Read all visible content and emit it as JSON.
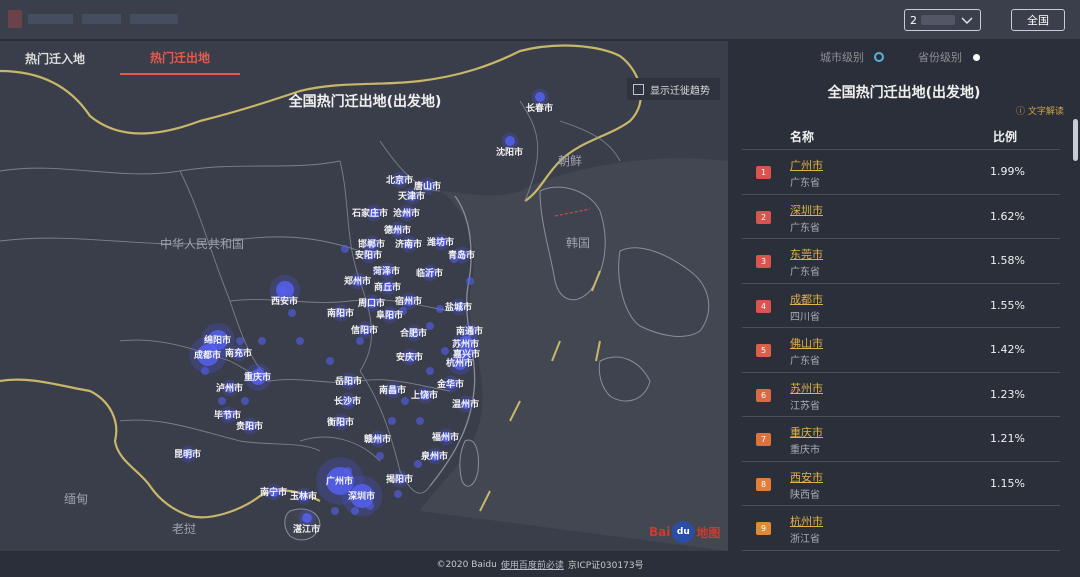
{
  "header": {
    "year_select_value": "2",
    "all_button": "全国"
  },
  "map": {
    "tabs": [
      "热门迁入地",
      "热门迁出地"
    ],
    "title": "全国热门迁出地(出发地)",
    "trend_toggle_label": "显示迁徙趋势",
    "country_labels": [
      "中华人民共和国",
      "朝鲜",
      "韩国",
      "缅甸",
      "老挝"
    ],
    "cities": [
      "长春市",
      "沈阳市",
      "北京市",
      "唐山市",
      "天津市",
      "石家庄市",
      "沧州市",
      "德州市",
      "邯郸市",
      "济南市",
      "潍坊市",
      "安阳市",
      "青岛市",
      "菏泽市",
      "临沂市",
      "郑州市",
      "西安市",
      "商丘市",
      "周口市",
      "宿州市",
      "阜阳市",
      "盐城市",
      "南阳市",
      "信阳市",
      "合肥市",
      "南通市",
      "苏州市",
      "嘉兴市",
      "杭州市",
      "绵阳市",
      "南充市",
      "安庆市",
      "成都市",
      "重庆市",
      "泸州市",
      "岳阳市",
      "南昌市",
      "金华市",
      "毕节市",
      "长沙市",
      "上饶市",
      "温州市",
      "贵阳市",
      "衡阳市",
      "赣州市",
      "福州市",
      "昆明市",
      "泉州市",
      "南宁市",
      "玉林市",
      "揭阳市",
      "湛江市",
      "广州市",
      "深圳市"
    ],
    "baidu_logo": [
      "Bai",
      "du",
      "地图"
    ]
  },
  "footer": {
    "copyright": "©2020 Baidu",
    "link": "使用百度前必读",
    "icp": "京ICP证030173号"
  },
  "panel": {
    "tabs": [
      "城市级别",
      "省份级别"
    ],
    "title": "全国热门迁出地(出发地)",
    "help_text": "文字解读",
    "columns": [
      "名称",
      "比例"
    ],
    "rows": [
      {
        "rank": "1",
        "city": "广州市",
        "province": "广东省",
        "pct": "1.99%"
      },
      {
        "rank": "2",
        "city": "深圳市",
        "province": "广东省",
        "pct": "1.62%"
      },
      {
        "rank": "3",
        "city": "东莞市",
        "province": "广东省",
        "pct": "1.58%"
      },
      {
        "rank": "4",
        "city": "成都市",
        "province": "四川省",
        "pct": "1.55%"
      },
      {
        "rank": "5",
        "city": "佛山市",
        "province": "广东省",
        "pct": "1.42%"
      },
      {
        "rank": "6",
        "city": "苏州市",
        "province": "江苏省",
        "pct": "1.23%"
      },
      {
        "rank": "7",
        "city": "重庆市",
        "province": "重庆市",
        "pct": "1.21%"
      },
      {
        "rank": "8",
        "city": "西安市",
        "province": "陕西省",
        "pct": "1.15%"
      },
      {
        "rank": "9",
        "city": "杭州市",
        "province": "浙江省",
        "pct": ""
      }
    ],
    "colors": {
      "rank_red": "#d9534f",
      "city_link": "#e0b24a",
      "accent": "#e65a4e"
    }
  }
}
